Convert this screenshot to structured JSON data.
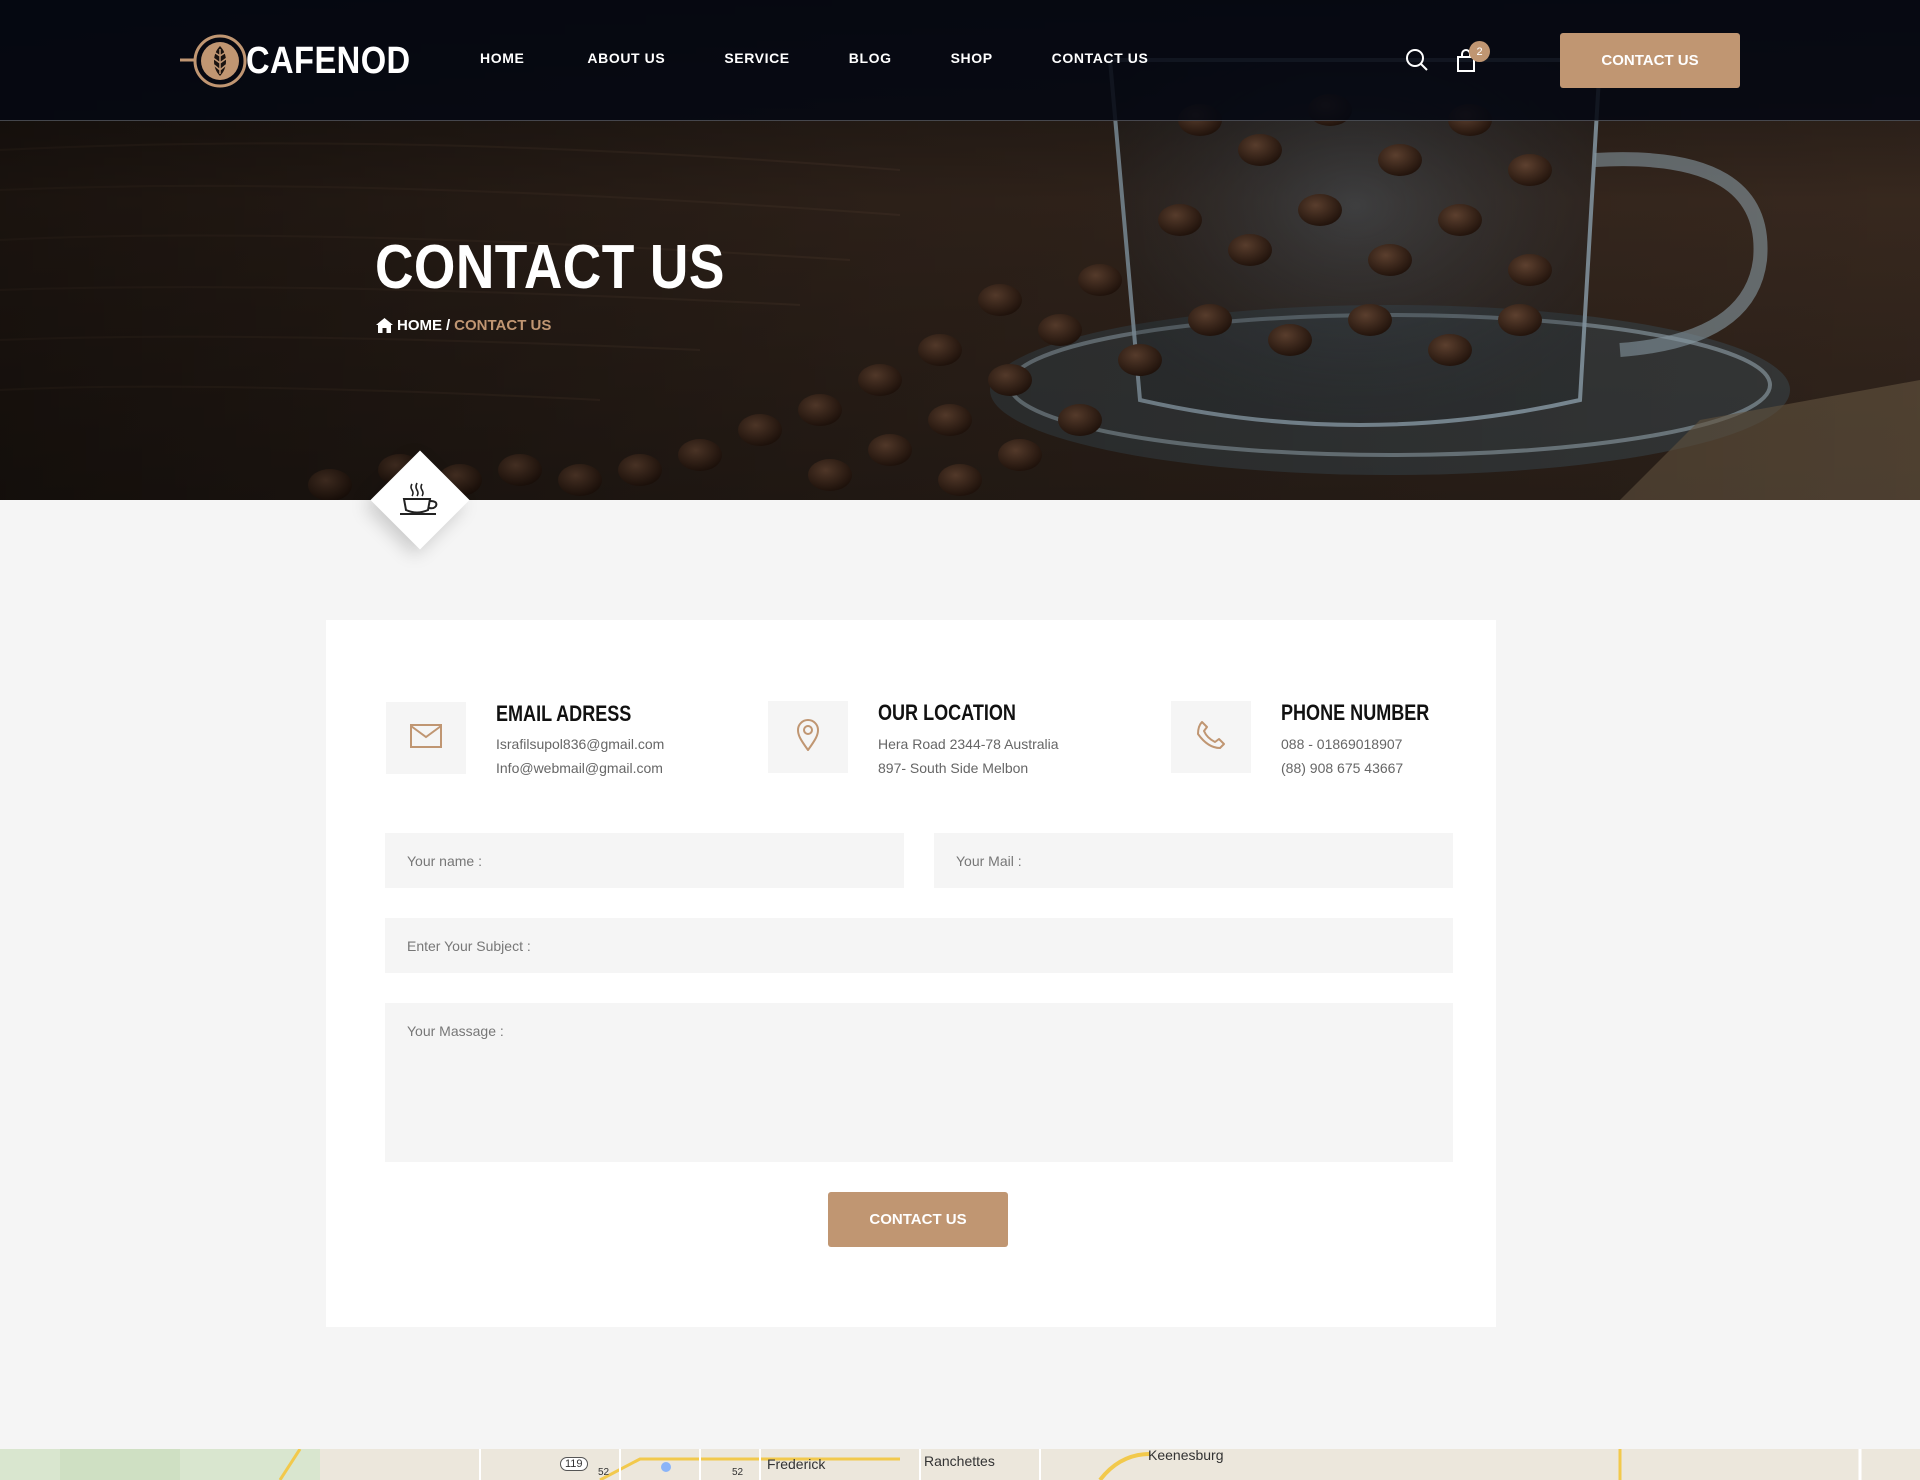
{
  "header": {
    "logo_text": "CAFENOD",
    "nav": [
      "HOME",
      "ABOUT US",
      "SERVICE",
      "BLOG",
      "SHOP",
      "CONTACT US"
    ],
    "cart_count": "2",
    "cta_label": "CONTACT US"
  },
  "hero": {
    "title": "CONTACT US",
    "breadcrumb_home": "HOME",
    "breadcrumb_sep": "/",
    "breadcrumb_current": "CONTACT US"
  },
  "contact": {
    "email": {
      "title": "EMAIL ADRESS",
      "line1": "Israfilsupol836@gmail.com",
      "line2": "Info@webmail@gmail.com"
    },
    "location": {
      "title": "OUR LOCATION",
      "line1": "Hera Road 2344-78 Australia",
      "line2": "897- South Side Melbon"
    },
    "phone": {
      "title": "PHONE NUMBER",
      "line1": "088 - 01869018907",
      "line2": "(88) 908 675 43667"
    },
    "form": {
      "name_placeholder": "Your name :",
      "mail_placeholder": "Your Mail :",
      "subject_placeholder": "Enter Your Subject :",
      "message_placeholder": "Your Massage :",
      "submit_label": "CONTACT US"
    }
  },
  "map": {
    "labels": [
      "Frederick",
      "Ranchettes",
      "Keenesburg",
      "119",
      "52",
      "52"
    ]
  },
  "colors": {
    "accent": "#c09672",
    "header_bg": "#050812",
    "page_bg": "#f5f5f5"
  }
}
